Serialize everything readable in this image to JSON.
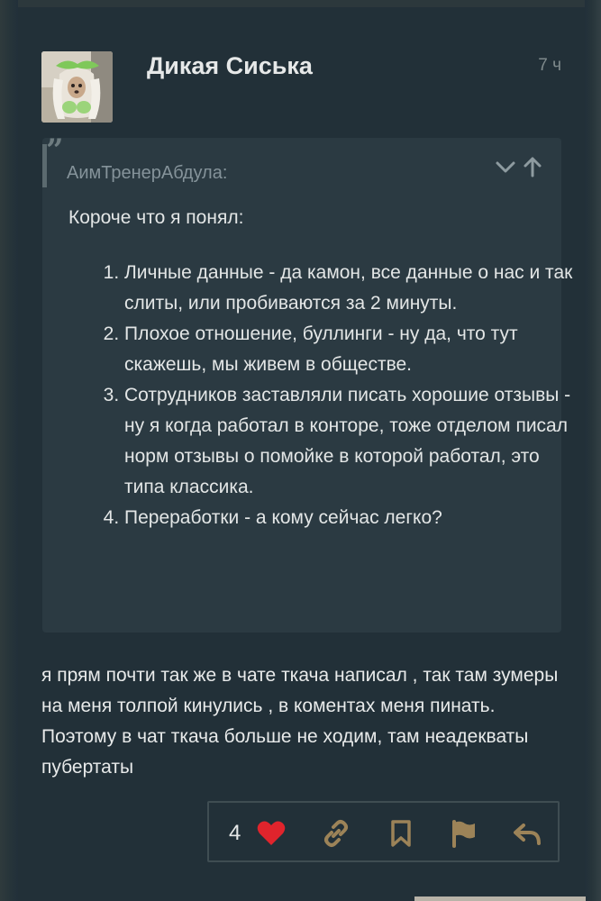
{
  "post": {
    "author": "Дикая Сиська",
    "time": "7 ч",
    "avatar_icon": "avatar-dog-photo",
    "quote": {
      "author": "АимТренерАбдула:",
      "intro": "Короче что я понял:",
      "items": [
        "Личные данные - да камон, все данные о нас и так слиты, или пробиваются за 2 минуты.",
        "Плохое отношение, буллинги - ну да, что тут скажешь, мы живем в обществе.",
        "Сотрудников заставляли писать хорошие отзывы - ну я когда работал в конторе, тоже отделом писал норм отзывы о помойке в которой работал, это типа классика.",
        "Переработки - а кому сейчас легко?"
      ]
    },
    "body": "я прям почти так же в чате ткача написал , так там зумеры на меня толпой кинулись , в коментах меня пинать. Поэтому в чат ткача больше не ходим, там неадекваты пубертаты"
  },
  "actions": {
    "like_count": "4",
    "icons": [
      "heart-icon",
      "link-icon",
      "bookmark-icon",
      "flag-icon",
      "reply-icon"
    ]
  },
  "colors": {
    "background": "#1e2a30",
    "card": "#223038",
    "quote_box": "#2b3a42",
    "accent_heart": "#e0242c",
    "accent_icons": "#9c8358",
    "text": "#e3e6e6",
    "muted": "#85939a"
  }
}
